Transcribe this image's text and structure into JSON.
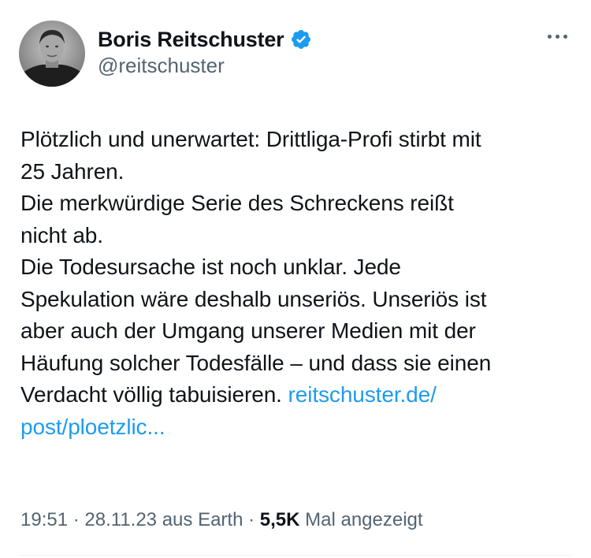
{
  "author": {
    "display_name": "Boris Reitschuster",
    "handle": "@reitschuster",
    "verified_icon": "verified-badge-icon",
    "avatar_style": "grayscale-photo"
  },
  "actions": {
    "more_icon": "more-options-icon"
  },
  "tweet": {
    "lines": [
      "Plötzlich und unerwartet: Drittliga-Profi stirbt mit",
      "25 Jahren.",
      "Die merkwürdige Serie des Schreckens reißt",
      "nicht ab.",
      "Die Todesursache ist noch unklar. Jede",
      "Spekulation wäre deshalb unseriös. Unseriös ist",
      "aber auch der Umgang unserer Medien mit der",
      "Häufung solcher Todesfälle – und dass sie einen"
    ],
    "last_line_text": "Verdacht völlig tabuisieren. ",
    "link_part1": "reitschuster.de/",
    "link_part2": "post/ploetzlic..."
  },
  "meta": {
    "time": "19:51",
    "separator": " · ",
    "date": "28.11.23",
    "location": " aus Earth",
    "views_count": "5,5K",
    "views_label": " Mal angezeigt"
  },
  "colors": {
    "text": "#0f1419",
    "secondary": "#536471",
    "link": "#1d9bf0",
    "verified": "#1d9bf0"
  }
}
